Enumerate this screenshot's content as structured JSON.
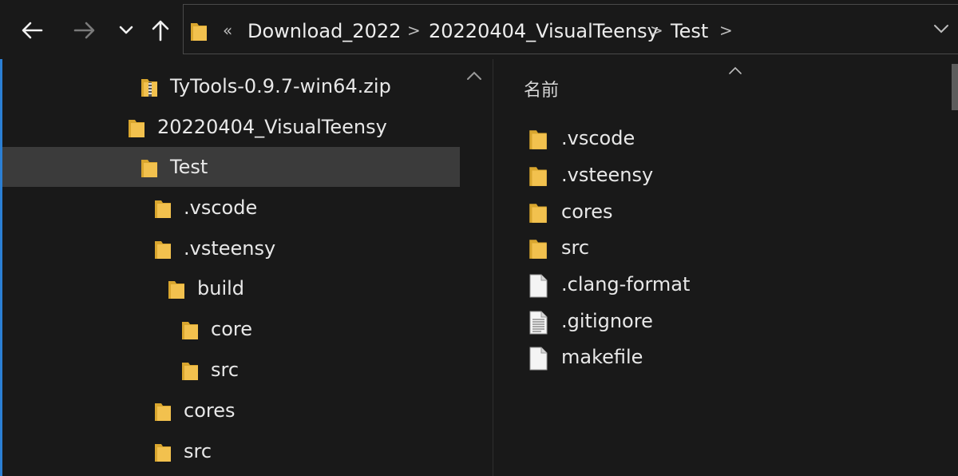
{
  "colors": {
    "folder": "#f2c14e",
    "folder_dark": "#d9a62e",
    "accent": "#2b7fd4",
    "selection": "#3b3b3b"
  },
  "nav": {
    "back_icon": "arrow-left-icon",
    "forward_icon": "arrow-right-icon",
    "recent_icon": "chevron-down-icon",
    "up_icon": "arrow-up-icon"
  },
  "address": {
    "overflow": "«",
    "crumbs": [
      "Download_2022",
      "20220404_VisualTeensy",
      "Test"
    ],
    "separator": ">"
  },
  "tree": [
    {
      "label": "TyTools-0.9.7-win64.zip",
      "icon": "zip-folder-icon"
    },
    {
      "label": "20220404_VisualTeensy",
      "icon": "folder-icon"
    },
    {
      "label": "Test",
      "icon": "folder-icon",
      "selected": true
    },
    {
      "label": ".vscode",
      "icon": "folder-icon"
    },
    {
      "label": ".vsteensy",
      "icon": "folder-icon"
    },
    {
      "label": "build",
      "icon": "folder-icon"
    },
    {
      "label": "core",
      "icon": "folder-icon"
    },
    {
      "label": "src",
      "icon": "folder-icon"
    },
    {
      "label": "cores",
      "icon": "folder-icon"
    },
    {
      "label": "src",
      "icon": "folder-icon"
    }
  ],
  "files": {
    "column_header": "名前",
    "items": [
      {
        "label": ".vscode",
        "icon": "folder-icon"
      },
      {
        "label": ".vsteensy",
        "icon": "folder-icon"
      },
      {
        "label": "cores",
        "icon": "folder-icon"
      },
      {
        "label": "src",
        "icon": "folder-icon"
      },
      {
        "label": ".clang-format",
        "icon": "file-icon"
      },
      {
        "label": ".gitignore",
        "icon": "text-file-icon"
      },
      {
        "label": "makefile",
        "icon": "file-icon"
      }
    ]
  }
}
